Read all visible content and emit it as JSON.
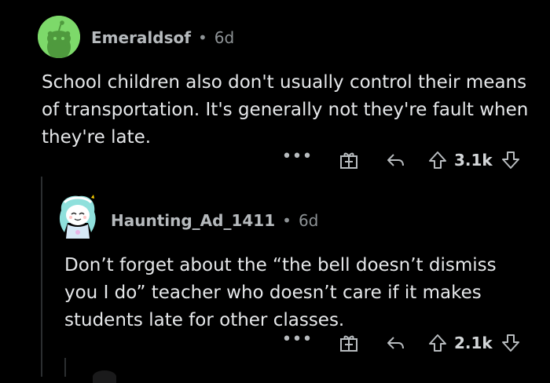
{
  "colors": {
    "background": "#000000",
    "avatar_green": "#7dd96a",
    "text": "#e6e8ea",
    "meta": "#8e9396"
  },
  "comments": [
    {
      "username": "Emeraldsof",
      "separator": "•",
      "age": "6d",
      "avatar_icon": "snoo-avatar-icon",
      "body": "School children also don't usually control their means of transportation. It's generally not they're fault when they're late.",
      "actions": {
        "more": "•••",
        "award_icon": "gift-award-icon",
        "reply_icon": "reply-arrow-icon",
        "upvote_icon": "upvote-arrow-icon",
        "score": "3.1k",
        "downvote_icon": "downvote-arrow-icon"
      }
    },
    {
      "username": "Haunting_Ad_1411",
      "separator": "•",
      "age": "6d",
      "avatar_icon": "snoo-avatar-icon",
      "body": "Don’t forget about the “the bell doesn’t dismiss you I do” teacher who doesn’t care if it makes students late for other classes.",
      "actions": {
        "more": "•••",
        "award_icon": "gift-award-icon",
        "reply_icon": "reply-arrow-icon",
        "upvote_icon": "upvote-arrow-icon",
        "score": "2.1k",
        "downvote_icon": "downvote-arrow-icon"
      }
    }
  ]
}
